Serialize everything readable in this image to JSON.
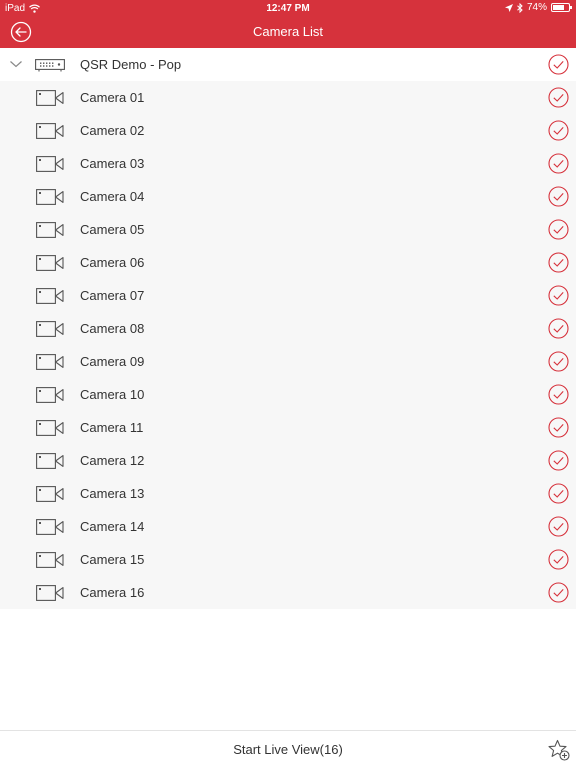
{
  "status_bar": {
    "device": "iPad",
    "time": "12:47 PM",
    "battery": "74%",
    "battery_level": 0.74,
    "icons": [
      "wifi-icon",
      "location-arrow-icon",
      "bluetooth-icon",
      "battery-icon"
    ]
  },
  "navbar": {
    "title": "Camera List",
    "back_icon": "back-arrow-circle-icon"
  },
  "device": {
    "name": "QSR Demo - Pop",
    "icon": "nvr-device-icon",
    "expanded": true
  },
  "cameras": [
    {
      "name": "Camera 01",
      "selected": true
    },
    {
      "name": "Camera 02",
      "selected": true
    },
    {
      "name": "Camera 03",
      "selected": true
    },
    {
      "name": "Camera 04",
      "selected": true
    },
    {
      "name": "Camera 05",
      "selected": true
    },
    {
      "name": "Camera 06",
      "selected": true
    },
    {
      "name": "Camera 07",
      "selected": true
    },
    {
      "name": "Camera 08",
      "selected": true
    },
    {
      "name": "Camera 09",
      "selected": true
    },
    {
      "name": "Camera 10",
      "selected": true
    },
    {
      "name": "Camera 11",
      "selected": true
    },
    {
      "name": "Camera 12",
      "selected": true
    },
    {
      "name": "Camera 13",
      "selected": true
    },
    {
      "name": "Camera 14",
      "selected": true
    },
    {
      "name": "Camera 15",
      "selected": true
    },
    {
      "name": "Camera 16",
      "selected": true
    }
  ],
  "bottom_bar": {
    "start_label": "Start Live View(16)",
    "favorite_icon": "star-add-icon"
  },
  "colors": {
    "accent": "#d6323c",
    "row_background": "#f7f7f7",
    "text": "#333333"
  }
}
